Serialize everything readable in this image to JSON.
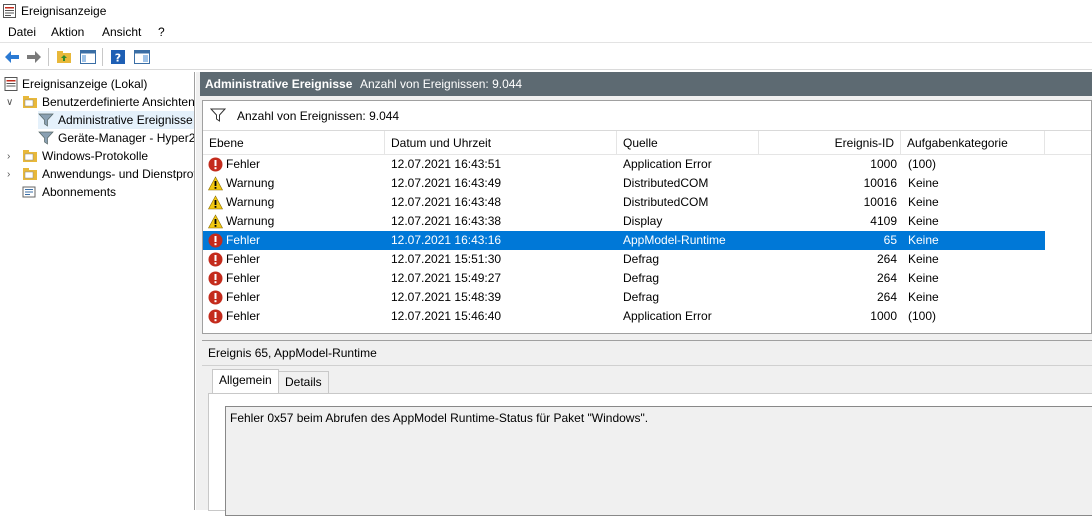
{
  "window": {
    "title": "Ereignisanzeige"
  },
  "menu": [
    "Datei",
    "Aktion",
    "Ansicht",
    "?"
  ],
  "tree": [
    {
      "label": "Ereignisanzeige (Lokal)",
      "icon": "event-viewer-icon"
    },
    {
      "label": "Benutzerdefinierte Ansichten",
      "icon": "folder-icon"
    },
    {
      "label": "Administrative Ereignisse",
      "icon": "filter-icon"
    },
    {
      "label": "Geräte-Manager - Hyper2",
      "icon": "filter-icon"
    },
    {
      "label": "Windows-Protokolle",
      "icon": "folder-icon"
    },
    {
      "label": "Anwendungs- und Dienstprotokolle",
      "icon": "folder-icon"
    },
    {
      "label": "Abonnements",
      "icon": "subscriptions-icon"
    }
  ],
  "header": {
    "title": "Administrative Ereignisse",
    "count": "Anzahl von Ereignissen: 9.044"
  },
  "filter": {
    "text": "Anzahl von Ereignissen: 9.044"
  },
  "columns": [
    "Ebene",
    "Datum und Uhrzeit",
    "Quelle",
    "Ereignis-ID",
    "Aufgabenkategorie"
  ],
  "events": [
    {
      "level": "Fehler",
      "type": "error",
      "date": "12.07.2021 16:43:51",
      "source": "Application Error",
      "id": "1000",
      "category": "(100)"
    },
    {
      "level": "Warnung",
      "type": "warning",
      "date": "12.07.2021 16:43:49",
      "source": "DistributedCOM",
      "id": "10016",
      "category": "Keine"
    },
    {
      "level": "Warnung",
      "type": "warning",
      "date": "12.07.2021 16:43:48",
      "source": "DistributedCOM",
      "id": "10016",
      "category": "Keine"
    },
    {
      "level": "Warnung",
      "type": "warning",
      "date": "12.07.2021 16:43:38",
      "source": "Display",
      "id": "4109",
      "category": "Keine"
    },
    {
      "level": "Fehler",
      "type": "error",
      "date": "12.07.2021 16:43:16",
      "source": "AppModel-Runtime",
      "id": "65",
      "category": "Keine",
      "selected": true
    },
    {
      "level": "Fehler",
      "type": "error",
      "date": "12.07.2021 15:51:30",
      "source": "Defrag",
      "id": "264",
      "category": "Keine"
    },
    {
      "level": "Fehler",
      "type": "error",
      "date": "12.07.2021 15:49:27",
      "source": "Defrag",
      "id": "264",
      "category": "Keine"
    },
    {
      "level": "Fehler",
      "type": "error",
      "date": "12.07.2021 15:48:39",
      "source": "Defrag",
      "id": "264",
      "category": "Keine"
    },
    {
      "level": "Fehler",
      "type": "error",
      "date": "12.07.2021 15:46:40",
      "source": "Application Error",
      "id": "1000",
      "category": "(100)"
    }
  ],
  "detail": {
    "title": "Ereignis 65, AppModel-Runtime",
    "tabs": [
      "Allgemein",
      "Details"
    ],
    "message": "Fehler 0x57 beim Abrufen des AppModel Runtime-Status für Paket \"Windows\"."
  },
  "colors": {
    "selection": "#0078d7",
    "header_bar": "#5d6a72",
    "error": "#c42b1c",
    "warning": "#f2c811"
  }
}
